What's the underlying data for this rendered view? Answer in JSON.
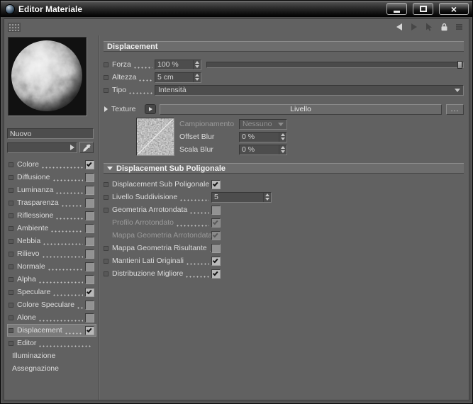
{
  "window": {
    "title": "Editor Materiale",
    "icons": {
      "close_glyph": "×"
    }
  },
  "toolbar": {
    "icons": [
      "dock-grip",
      "history-back",
      "history-forward",
      "pick-arrow",
      "lock",
      "panel-menu"
    ]
  },
  "sidebar": {
    "material_name": "Nuovo",
    "channels": [
      {
        "label": "Colore",
        "checkbox": true,
        "checked": true,
        "dots": true
      },
      {
        "label": "Diffusione",
        "checkbox": true,
        "checked": false,
        "dots": true
      },
      {
        "label": "Luminanza",
        "checkbox": true,
        "checked": false,
        "dots": true
      },
      {
        "label": "Trasparenza",
        "checkbox": true,
        "checked": false,
        "dots": true
      },
      {
        "label": "Riflessione",
        "checkbox": true,
        "checked": false,
        "dots": true
      },
      {
        "label": "Ambiente",
        "checkbox": true,
        "checked": false,
        "dots": true
      },
      {
        "label": "Nebbia",
        "checkbox": true,
        "checked": false,
        "dots": true
      },
      {
        "label": "Rilievo",
        "checkbox": true,
        "checked": false,
        "dots": true
      },
      {
        "label": "Normale",
        "checkbox": true,
        "checked": false,
        "dots": true
      },
      {
        "label": "Alpha",
        "checkbox": true,
        "checked": false,
        "dots": true
      },
      {
        "label": "Speculare",
        "checkbox": true,
        "checked": true,
        "dots": true
      },
      {
        "label": "Colore Speculare",
        "checkbox": true,
        "checked": false,
        "dots": true
      },
      {
        "label": "Alone",
        "checkbox": true,
        "checked": false,
        "dots": true
      },
      {
        "label": "Displacement",
        "checkbox": true,
        "checked": true,
        "dots": true,
        "selected": true
      },
      {
        "label": "Editor",
        "checkbox": false,
        "checked": false,
        "dots": true
      },
      {
        "label": "Illuminazione",
        "checkbox": false,
        "checked": false,
        "dots": false
      },
      {
        "label": "Assegnazione",
        "checkbox": false,
        "checked": false,
        "dots": false
      }
    ]
  },
  "panel": {
    "header": "Displacement",
    "params": {
      "forza": {
        "label": "Forza",
        "value": "100 %"
      },
      "altezza": {
        "label": "Altezza",
        "value": "5 cm"
      },
      "tipo": {
        "label": "Tipo",
        "value": "Intensità"
      },
      "texture": {
        "label": "Texture",
        "value": "Livello",
        "browse_label": "..."
      },
      "campionamento": {
        "label": "Campionamento",
        "value": "Nessuno",
        "enabled": false
      },
      "offset_blur": {
        "label": "Offset Blur",
        "value": "0 %"
      },
      "scala_blur": {
        "label": "Scala Blur",
        "value": "0 %"
      }
    },
    "subsection": {
      "header": "Displacement Sub Poligonale",
      "rows": [
        {
          "label": "Displacement Sub Poligonale",
          "control": "checkbox",
          "checked": true,
          "enabled": true
        },
        {
          "label": "Livello Suddivisione",
          "control": "spinner",
          "value": "5",
          "enabled": true
        },
        {
          "label": "Geometria Arrotondata",
          "control": "checkbox",
          "checked": false,
          "enabled": true
        },
        {
          "label": "Profilo Arrotondato",
          "control": "checkbox",
          "checked": true,
          "enabled": false
        },
        {
          "label": "Mappa Geometria Arrotondata",
          "control": "checkbox",
          "checked": true,
          "enabled": false
        },
        {
          "label": "Mappa Geometria Risultante",
          "control": "checkbox",
          "checked": false,
          "enabled": true
        },
        {
          "label": "Mantieni Lati Originali",
          "control": "checkbox",
          "checked": true,
          "enabled": true
        },
        {
          "label": "Distribuzione Migliore",
          "control": "checkbox",
          "checked": true,
          "enabled": true
        }
      ]
    }
  },
  "colors": {
    "panel_bg": "#616161",
    "field_bg": "#4d4d4d",
    "text": "#dcdcdc",
    "disabled_text": "#9a9a9a",
    "header_bar_bg": "#6d6d6d",
    "titlebar_text": "#ffffff"
  }
}
